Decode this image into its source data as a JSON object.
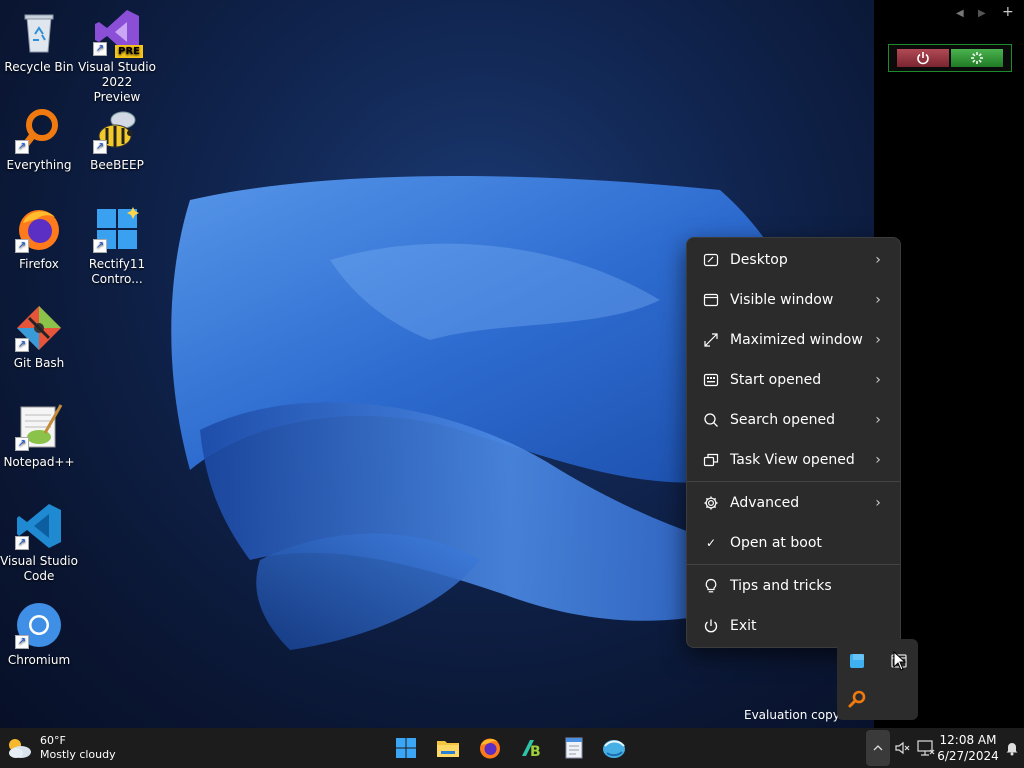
{
  "desktop": {
    "icons": [
      {
        "label": "Recycle Bin",
        "icon": "recycle-bin-icon"
      },
      {
        "label": "Visual Studio 2022 Preview",
        "icon": "visual-studio-preview-icon",
        "badge": "PRE"
      },
      {
        "label": "Everything",
        "icon": "everything-search-icon"
      },
      {
        "label": "BeeBEEP",
        "icon": "beebeep-icon"
      },
      {
        "label": "Firefox",
        "icon": "firefox-icon"
      },
      {
        "label": "Rectify11 Contro...",
        "icon": "rectify11-icon"
      },
      {
        "label": "Git Bash",
        "icon": "git-bash-icon"
      },
      {
        "label": "Notepad++",
        "icon": "notepad-plus-plus-icon"
      },
      {
        "label": "Visual Studio Code",
        "icon": "vscode-icon"
      },
      {
        "label": "Chromium",
        "icon": "chromium-icon"
      }
    ],
    "watermark": "Evaluation copy. B"
  },
  "context_menu": {
    "items": [
      {
        "label": "Desktop",
        "icon": "desktop-icon",
        "submenu": true
      },
      {
        "label": "Visible window",
        "icon": "window-icon",
        "submenu": true
      },
      {
        "label": "Maximized window",
        "icon": "maximize-icon",
        "submenu": true
      },
      {
        "label": "Start opened",
        "icon": "start-menu-icon",
        "submenu": true
      },
      {
        "label": "Search opened",
        "icon": "search-icon",
        "submenu": true
      },
      {
        "label": "Task View opened",
        "icon": "task-view-icon",
        "submenu": true
      },
      {
        "label": "Advanced",
        "icon": "gear-icon",
        "submenu": true
      },
      {
        "label": "Open at boot",
        "icon": "checkmark-icon",
        "checked": true
      },
      {
        "label": "Tips and tricks",
        "icon": "lightbulb-icon"
      },
      {
        "label": "Exit",
        "icon": "power-icon"
      }
    ],
    "chevron": "›",
    "check": "✓"
  },
  "taskbar": {
    "weather": {
      "temp": "60°F",
      "condition": "Mostly cloudy"
    },
    "apps": [
      "start-button",
      "file-explorer",
      "firefox",
      "taskbar-tool",
      "notepad-app",
      "browser-app"
    ],
    "clock": {
      "time": "12:08 AM",
      "date": "6/27/2024"
    }
  },
  "side_panel": {
    "nav_prev": "◀",
    "nav_next": "▶",
    "nav_add": "+"
  },
  "colors": {
    "menu_bg": "#2b2b2b",
    "taskbar_bg": "#1c1c1c",
    "accent": "#4aa0f0"
  }
}
